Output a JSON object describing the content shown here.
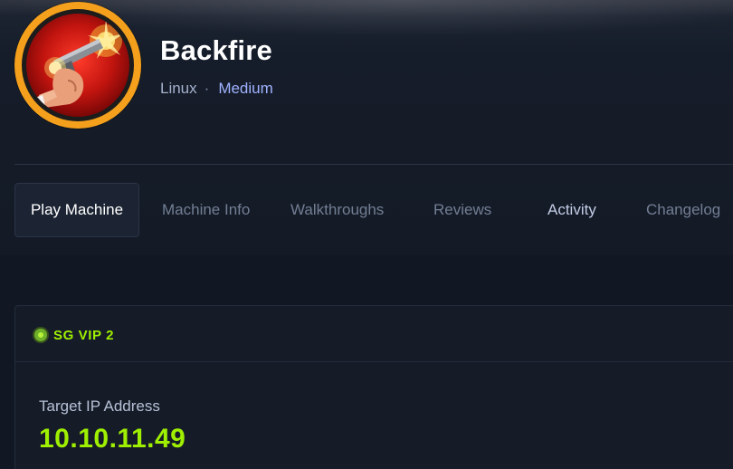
{
  "machine": {
    "name": "Backfire",
    "os": "Linux",
    "separator": "·",
    "difficulty": "Medium",
    "avatar_icon": "pistol-firing-icon"
  },
  "tabs": [
    {
      "label": "Play Machine",
      "active": true
    },
    {
      "label": "Machine Info",
      "active": false
    },
    {
      "label": "Walkthroughs",
      "active": false
    },
    {
      "label": "Reviews",
      "active": false
    },
    {
      "label": "Activity",
      "active": false
    },
    {
      "label": "Changelog",
      "active": false
    }
  ],
  "connection": {
    "server": "SG VIP 2",
    "status_color": "#9fef00",
    "target_ip_label": "Target IP Address",
    "target_ip": "10.10.11.49"
  },
  "colors": {
    "accent_green": "#9fef00",
    "difficulty_blue": "#9fb2ff",
    "avatar_ring": "#f4a01c"
  }
}
